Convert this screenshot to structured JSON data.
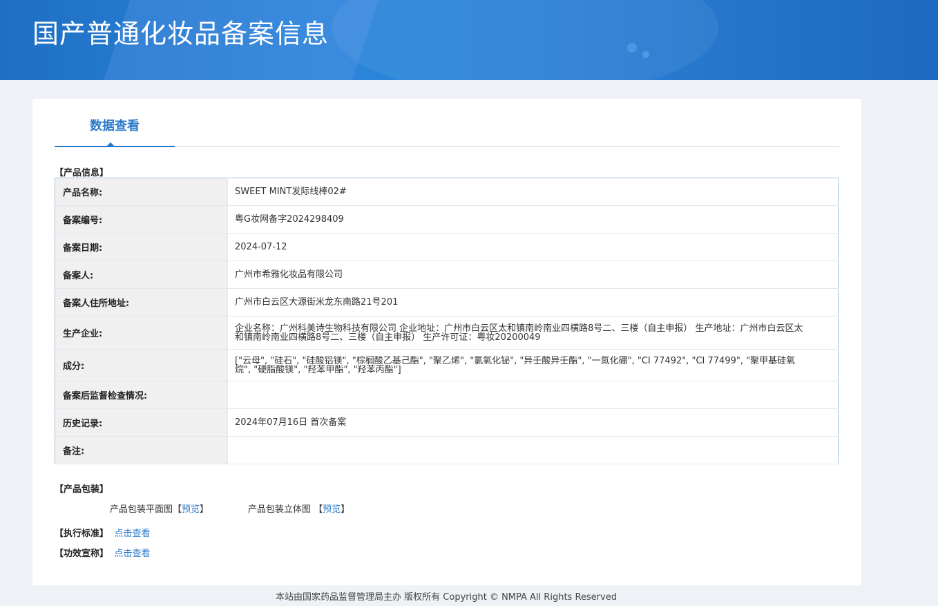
{
  "header": {
    "title": "国产普通化妆品备案信息"
  },
  "tabs": [
    {
      "label": "数据查看"
    }
  ],
  "product_info": {
    "section_label": "【产品信息】",
    "rows": [
      {
        "key": "产品名称:",
        "value": "SWEET MINT发际线棒02#"
      },
      {
        "key": "备案编号:",
        "value": "粤G妆网备字2024298409"
      },
      {
        "key": "备案日期:",
        "value": "2024-07-12"
      },
      {
        "key": "备案人:",
        "value": "广州市希雅化妆品有限公司"
      },
      {
        "key": "备案人住所地址:",
        "value": "广州市白云区大源街米龙东南路21号201"
      },
      {
        "key": "生产企业:",
        "value": "企业名称：广州科美诗生物科技有限公司 企业地址：广州市白云区太和镇南岭南业四横路8号二、三楼（自主申报） 生产地址：广州市白云区太和镇南岭南业四横路8号二、三楼（自主申报） 生产许可证：粤妆20200049"
      },
      {
        "key": "成分:",
        "value": "[\"云母\", \"硅石\", \"硅酸铝镁\", \"棕榈酸乙基己酯\", \"聚乙烯\", \"氯氧化铋\", \"异壬酸异壬酯\", \"一氮化硼\", \"CI 77492\", \"CI 77499\", \"聚甲基硅氧烷\", \"硬脂酸镁\", \"羟苯甲酯\", \"羟苯丙酯\"]"
      },
      {
        "key": "备案后监督检查情况:",
        "value": ""
      },
      {
        "key": "历史记录:",
        "value": "2024年07月16日 首次备案"
      },
      {
        "key": "备注:",
        "value": ""
      }
    ]
  },
  "packaging": {
    "section_label": "【产品包装】",
    "flat": {
      "label": "产品包装平面图",
      "bracket_open": "【",
      "link": "预览",
      "bracket_close": "】"
    },
    "stereo": {
      "label": "产品包装立体图",
      "bracket_open": "【",
      "link": "预览",
      "bracket_close": "】"
    }
  },
  "standard": {
    "section_label": "【执行标准】",
    "link": "点击查看"
  },
  "efficacy": {
    "section_label": "【功效宣称】",
    "link": "点击查看"
  },
  "footer": {
    "text": "本站由国家药品监督管理局主办 版权所有 Copyright © NMPA All Rights Reserved"
  }
}
